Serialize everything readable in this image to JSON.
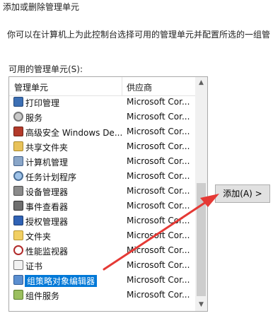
{
  "dialog": {
    "title": "添加或删除管理单元",
    "description": "你可以在计算机上为此控制台选择可用的管理单元并配置所选的一组管"
  },
  "available": {
    "label": "可用的管理单元(S):",
    "columns": {
      "name": "管理单元",
      "vendor": "供应商"
    },
    "items": [
      {
        "name": "打印管理",
        "vendor": "Microsoft Cor...",
        "icon": "printer-icon"
      },
      {
        "name": "服务",
        "vendor": "Microsoft Cor...",
        "icon": "services-icon"
      },
      {
        "name": "高级安全 Windows De...",
        "vendor": "Microsoft Cor...",
        "icon": "firewall-icon"
      },
      {
        "name": "共享文件夹",
        "vendor": "Microsoft Cor...",
        "icon": "shared-folder-icon"
      },
      {
        "name": "计算机管理",
        "vendor": "Microsoft Cor...",
        "icon": "computer-management-icon"
      },
      {
        "name": "任务计划程序",
        "vendor": "Microsoft Cor...",
        "icon": "task-scheduler-icon"
      },
      {
        "name": "设备管理器",
        "vendor": "Microsoft Cor...",
        "icon": "device-manager-icon"
      },
      {
        "name": "事件查看器",
        "vendor": "Microsoft Cor...",
        "icon": "event-viewer-icon"
      },
      {
        "name": "授权管理器",
        "vendor": "Microsoft Cor...",
        "icon": "authorization-manager-icon"
      },
      {
        "name": "文件夹",
        "vendor": "Microsoft Cor...",
        "icon": "folder-icon"
      },
      {
        "name": "性能监视器",
        "vendor": "Microsoft Cor...",
        "icon": "performance-monitor-icon"
      },
      {
        "name": "证书",
        "vendor": "Microsoft Cor...",
        "icon": "certificates-icon"
      },
      {
        "name": "组策略对象编辑器",
        "vendor": "Microsoft Cor...",
        "icon": "group-policy-icon",
        "selected": true
      },
      {
        "name": "组件服务",
        "vendor": "Microsoft Cor...",
        "icon": "component-services-icon"
      }
    ]
  },
  "add_button": {
    "label": "添加(A) >"
  },
  "colors": {
    "selection": "#0078d7",
    "arrow": "#e53935"
  }
}
